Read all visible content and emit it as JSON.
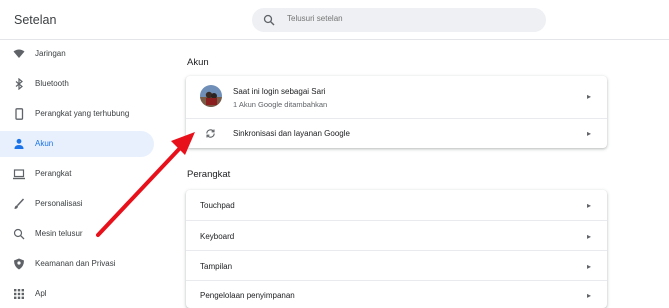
{
  "app": {
    "title": "Setelan"
  },
  "search": {
    "placeholder": "Telusuri setelan"
  },
  "sidebar": {
    "items": [
      {
        "label": "Jaringan",
        "icon": "wifi-icon"
      },
      {
        "label": "Bluetooth",
        "icon": "bluetooth-icon"
      },
      {
        "label": "Perangkat yang terhubung",
        "icon": "phone-icon"
      },
      {
        "label": "Akun",
        "icon": "person-icon",
        "active": true
      },
      {
        "label": "Perangkat",
        "icon": "laptop-icon"
      },
      {
        "label": "Personalisasi",
        "icon": "brush-icon"
      },
      {
        "label": "Mesin telusur",
        "icon": "search-icon"
      },
      {
        "label": "Keamanan dan Privasi",
        "icon": "shield-icon"
      },
      {
        "label": "Apl",
        "icon": "apps-grid-icon"
      }
    ]
  },
  "main": {
    "akun": {
      "title": "Akun",
      "signed_in": "Saat ini login sebagai Sari",
      "accounts_added": "1 Akun Google ditambahkan",
      "sync": "Sinkronisasi dan layanan Google"
    },
    "perangkat": {
      "title": "Perangkat",
      "items": [
        "Touchpad",
        "Keyboard",
        "Tampilan",
        "Pengelolaan penyimpanan"
      ]
    },
    "arrow_glyph": "▸"
  },
  "colors": {
    "accent": "#1a73e8",
    "active_bg": "#e8f0fe",
    "annotation": "#e8101a"
  }
}
